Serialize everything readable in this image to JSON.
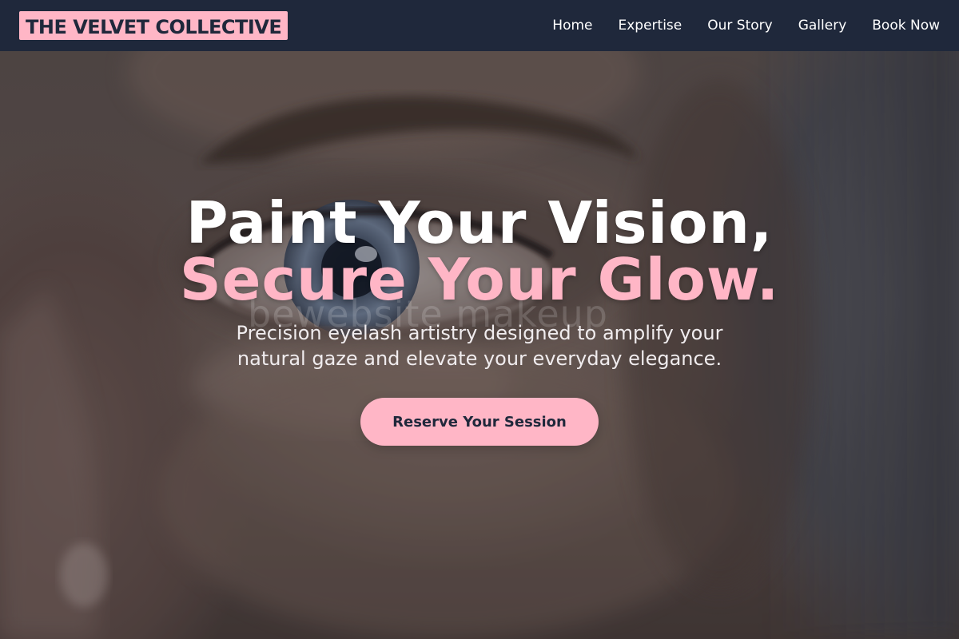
{
  "nav": {
    "brand": "THE VELVET COLLECTIVE",
    "links": [
      "Home",
      "Expertise",
      "Our Story",
      "Gallery",
      "Book Now"
    ]
  },
  "hero": {
    "headline_line1": "Paint Your Vision,",
    "headline_line2": "Secure Your Glow.",
    "subtitle": "Precision eyelash artistry designed to amplify your natural gaze and elevate your everyday elegance.",
    "cta_label": "Reserve Your Session",
    "watermark": "bewebsite makeup",
    "background_image": "close-up of a woman's eye"
  },
  "colors": {
    "navbar": "#1f283b",
    "accent_pink": "#ffb6c6",
    "headline_white": "#ffffff",
    "text_dark": "#1f283b"
  }
}
